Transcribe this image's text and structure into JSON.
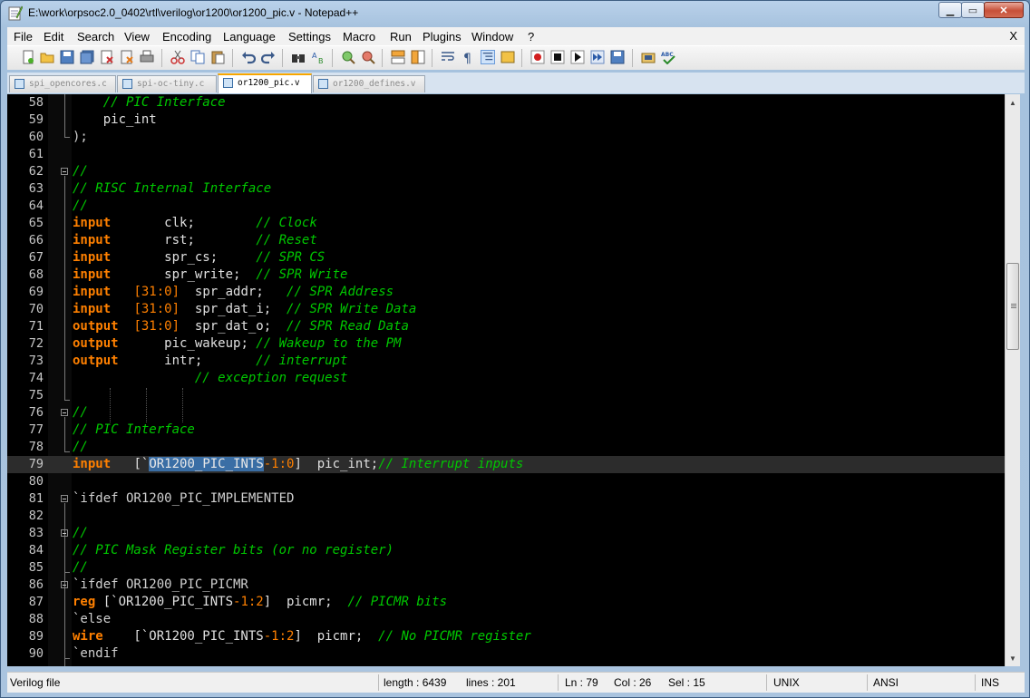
{
  "window": {
    "title": "E:\\work\\orpsoc2.0_0402\\rtl\\verilog\\or1200\\or1200_pic.v - Notepad++"
  },
  "menu": [
    "File",
    "Edit",
    "Search",
    "View",
    "Encoding",
    "Language",
    "Settings",
    "Macro",
    "Run",
    "Plugins",
    "Window",
    "?"
  ],
  "menu_close": "X",
  "tabs": [
    {
      "label": "spi_opencores.c",
      "active": false
    },
    {
      "label": "spi-oc-tiny.c",
      "active": false
    },
    {
      "label": "or1200_pic.v",
      "active": true
    },
    {
      "label": "or1200_defines.v",
      "active": false
    }
  ],
  "editor": {
    "lines": [
      {
        "n": "58",
        "tokens": [
          [
            "",
            "    "
          ],
          [
            "cm",
            "// PIC Interface"
          ]
        ]
      },
      {
        "n": "59",
        "tokens": [
          [
            "",
            "    pic_int"
          ]
        ]
      },
      {
        "n": "60",
        "tokens": [
          [
            "pp",
            ");"
          ]
        ]
      },
      {
        "n": "61",
        "tokens": []
      },
      {
        "n": "62",
        "tokens": [
          [
            "cm",
            "//"
          ]
        ]
      },
      {
        "n": "63",
        "tokens": [
          [
            "cm",
            "// RISC Internal Interface"
          ]
        ]
      },
      {
        "n": "64",
        "tokens": [
          [
            "cm",
            "//"
          ]
        ]
      },
      {
        "n": "65",
        "tokens": [
          [
            "kw",
            "input"
          ],
          [
            "",
            "       clk;        "
          ],
          [
            "cm",
            "// Clock"
          ]
        ]
      },
      {
        "n": "66",
        "tokens": [
          [
            "kw",
            "input"
          ],
          [
            "",
            "       rst;        "
          ],
          [
            "cm",
            "// Reset"
          ]
        ]
      },
      {
        "n": "67",
        "tokens": [
          [
            "kw",
            "input"
          ],
          [
            "",
            "       spr_cs;     "
          ],
          [
            "cm",
            "// SPR CS"
          ]
        ]
      },
      {
        "n": "68",
        "tokens": [
          [
            "kw",
            "input"
          ],
          [
            "",
            "       spr_write;  "
          ],
          [
            "cm",
            "// SPR Write"
          ]
        ]
      },
      {
        "n": "69",
        "tokens": [
          [
            "kw",
            "input"
          ],
          [
            "",
            "   "
          ],
          [
            "nm",
            "[31:0]"
          ],
          [
            "",
            "  spr_addr;   "
          ],
          [
            "cm",
            "// SPR Address"
          ]
        ]
      },
      {
        "n": "70",
        "tokens": [
          [
            "kw",
            "input"
          ],
          [
            "",
            "   "
          ],
          [
            "nm",
            "[31:0]"
          ],
          [
            "",
            "  spr_dat_i;  "
          ],
          [
            "cm",
            "// SPR Write Data"
          ]
        ]
      },
      {
        "n": "71",
        "tokens": [
          [
            "kw",
            "output"
          ],
          [
            "",
            "  "
          ],
          [
            "nm",
            "[31:0]"
          ],
          [
            "",
            "  spr_dat_o;  "
          ],
          [
            "cm",
            "// SPR Read Data"
          ]
        ]
      },
      {
        "n": "72",
        "tokens": [
          [
            "kw",
            "output"
          ],
          [
            "",
            "      pic_wakeup; "
          ],
          [
            "cm",
            "// Wakeup to the PM"
          ]
        ]
      },
      {
        "n": "73",
        "tokens": [
          [
            "kw",
            "output"
          ],
          [
            "",
            "      intr;       "
          ],
          [
            "cm",
            "// interrupt"
          ]
        ]
      },
      {
        "n": "74",
        "tokens": [
          [
            "",
            "                "
          ],
          [
            "cm",
            "// exception request"
          ]
        ]
      },
      {
        "n": "75",
        "tokens": []
      },
      {
        "n": "76",
        "tokens": [
          [
            "cm",
            "//"
          ]
        ]
      },
      {
        "n": "77",
        "tokens": [
          [
            "cm",
            "// PIC Interface"
          ]
        ]
      },
      {
        "n": "78",
        "tokens": [
          [
            "cm",
            "//"
          ]
        ]
      },
      {
        "n": "79",
        "tokens": [
          [
            "kw",
            "input"
          ],
          [
            "",
            "   [`"
          ],
          [
            "sel",
            "OR1200_PIC_INTS"
          ],
          [
            "nm",
            "-1:0"
          ],
          [
            "",
            "]  pic_int;"
          ],
          [
            "cm",
            "// Interrupt inputs"
          ]
        ]
      },
      {
        "n": "80",
        "tokens": []
      },
      {
        "n": "81",
        "tokens": [
          [
            "pp",
            "`ifdef OR1200_PIC_IMPLEMENTED"
          ]
        ]
      },
      {
        "n": "82",
        "tokens": []
      },
      {
        "n": "83",
        "tokens": [
          [
            "cm",
            "//"
          ]
        ]
      },
      {
        "n": "84",
        "tokens": [
          [
            "cm",
            "// PIC Mask Register bits (or no register)"
          ]
        ]
      },
      {
        "n": "85",
        "tokens": [
          [
            "cm",
            "//"
          ]
        ]
      },
      {
        "n": "86",
        "tokens": [
          [
            "pp",
            "`ifdef OR1200_PIC_PICMR"
          ]
        ]
      },
      {
        "n": "87",
        "tokens": [
          [
            "kw",
            "reg"
          ],
          [
            "",
            " [`OR1200_PIC_INTS"
          ],
          [
            "nm",
            "-1:2"
          ],
          [
            "",
            "]  picmr;  "
          ],
          [
            "cm",
            "// PICMR bits"
          ]
        ]
      },
      {
        "n": "88",
        "tokens": [
          [
            "pp",
            "`else"
          ]
        ]
      },
      {
        "n": "89",
        "tokens": [
          [
            "kw",
            "wire"
          ],
          [
            "",
            "    [`OR1200_PIC_INTS"
          ],
          [
            "nm",
            "-1:2"
          ],
          [
            "",
            "]  picmr;  "
          ],
          [
            "cm",
            "// No PICMR register"
          ]
        ]
      },
      {
        "n": "90",
        "tokens": [
          [
            "pp",
            "`endif"
          ]
        ]
      }
    ]
  },
  "status": {
    "filetype": "Verilog file",
    "length": "length : 6439",
    "lines": "lines : 201",
    "ln": "Ln : 79",
    "col": "Col : 26",
    "sel": "Sel : 15",
    "eol": "UNIX",
    "encoding": "ANSI",
    "mode": "INS"
  },
  "colors": {
    "keyword": "#ff8000",
    "comment": "#00c800",
    "background": "#000000",
    "selection": "#3a6ea5"
  }
}
